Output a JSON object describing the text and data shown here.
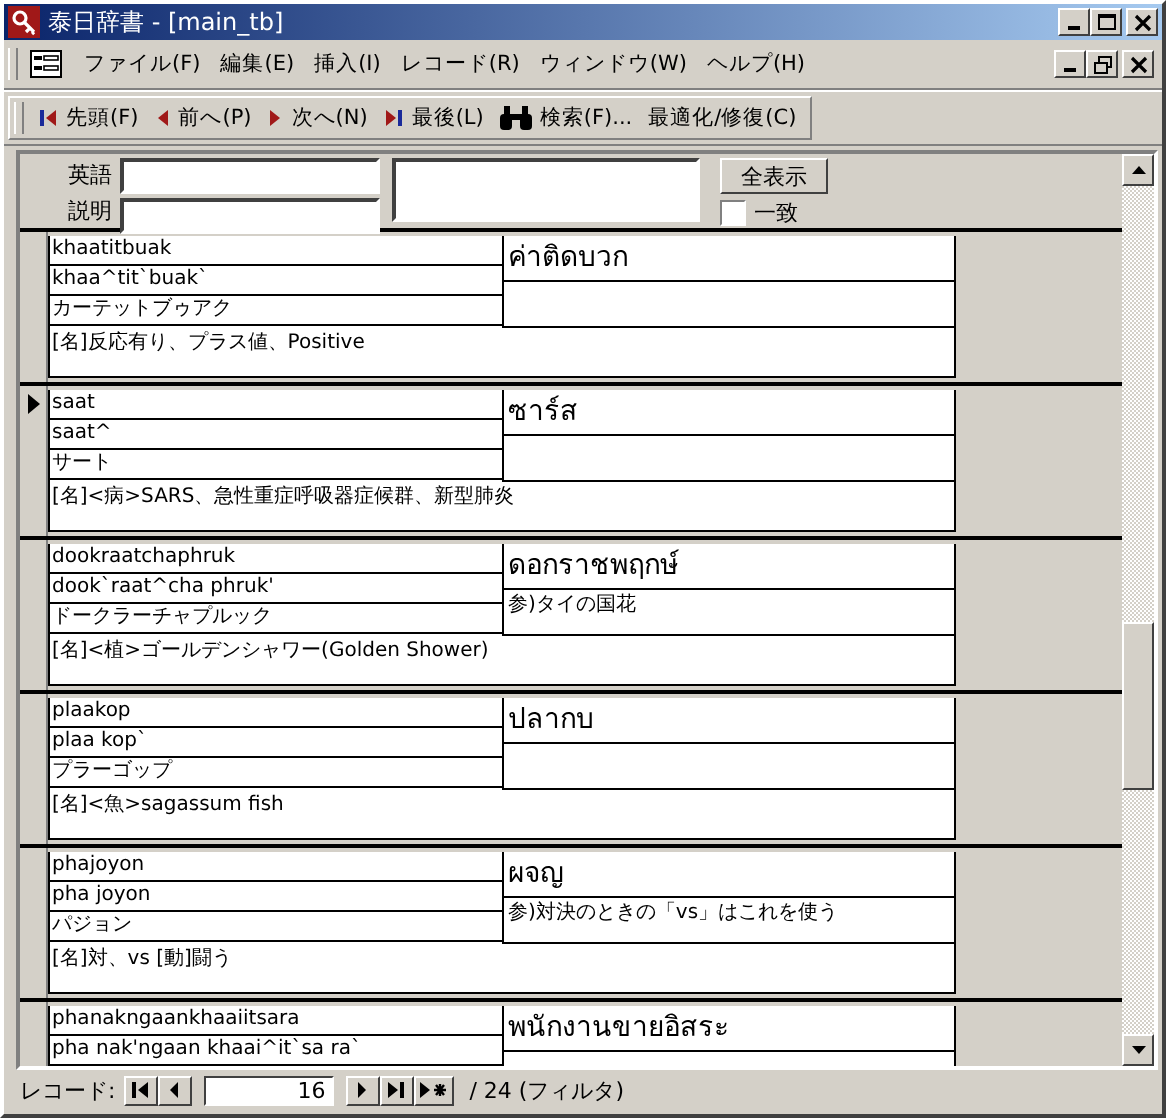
{
  "window": {
    "title": "泰日辞書 - [main_tb]"
  },
  "menu_bar": [
    "ファイル(F)",
    "編集(E)",
    "挿入(I)",
    "レコード(R)",
    "ウィンドウ(W)",
    "ヘルプ(H)"
  ],
  "toolbar": [
    {
      "kind": "first",
      "label": "先頭(F)"
    },
    {
      "kind": "prev",
      "label": "前へ(P)"
    },
    {
      "kind": "next",
      "label": "次へ(N)"
    },
    {
      "kind": "last",
      "label": "最後(L)"
    },
    {
      "kind": "search",
      "label": "検索(F)..."
    },
    {
      "kind": "plain",
      "label": "最適化/修復(C)"
    }
  ],
  "filter": {
    "english_label": "英語",
    "description_label": "説明",
    "show_all_button": "全表示",
    "match_checkbox": {
      "label": "一致",
      "checked": false
    }
  },
  "records": [
    {
      "romanized": "khaatitbuak",
      "tone_romanized": "khaa^tit`buak`",
      "katakana": "カーテットブゥアク",
      "thai": "ค่าติดบวก",
      "definition": "[名]反応有り、プラス値、Positive",
      "selected": false
    },
    {
      "romanized": "saat",
      "tone_romanized": "saat^",
      "katakana": "サート",
      "thai": "ซาร์ส",
      "definition": "[名]<病>SARS、急性重症呼吸器症候群、新型肺炎",
      "selected": true
    },
    {
      "romanized": "dookraatchaphruk",
      "tone_romanized": "dook`raat^cha phruk'",
      "katakana": "ドークラーチャプルック",
      "thai": "ดอกราชพฤกษ์",
      "note": "参)タイの国花",
      "definition": "[名]<植>ゴールデンシャワー(Golden Shower)",
      "selected": false
    },
    {
      "romanized": "plaakop",
      "tone_romanized": "plaa kop`",
      "katakana": "プラーゴップ",
      "thai": "ปลากบ",
      "definition": "[名]<魚>sagassum fish",
      "selected": false
    },
    {
      "romanized": "phajoyon",
      "tone_romanized": "pha joyon",
      "katakana": "パジョン",
      "thai": "ผจญ",
      "note": "参)対決のときの「vs」はこれを使う",
      "definition": "[名]対、vs [動]闘う",
      "selected": false
    },
    {
      "romanized": "phanakngaankhaaiitsara",
      "tone_romanized": "pha nak'ngaan khaai^it`sa ra`",
      "thai": "พนักงานขายอิสระ",
      "selected": false
    }
  ],
  "navigation": {
    "label": "レコード:",
    "current": "16",
    "total": "/ 24 (フィルタ)"
  }
}
